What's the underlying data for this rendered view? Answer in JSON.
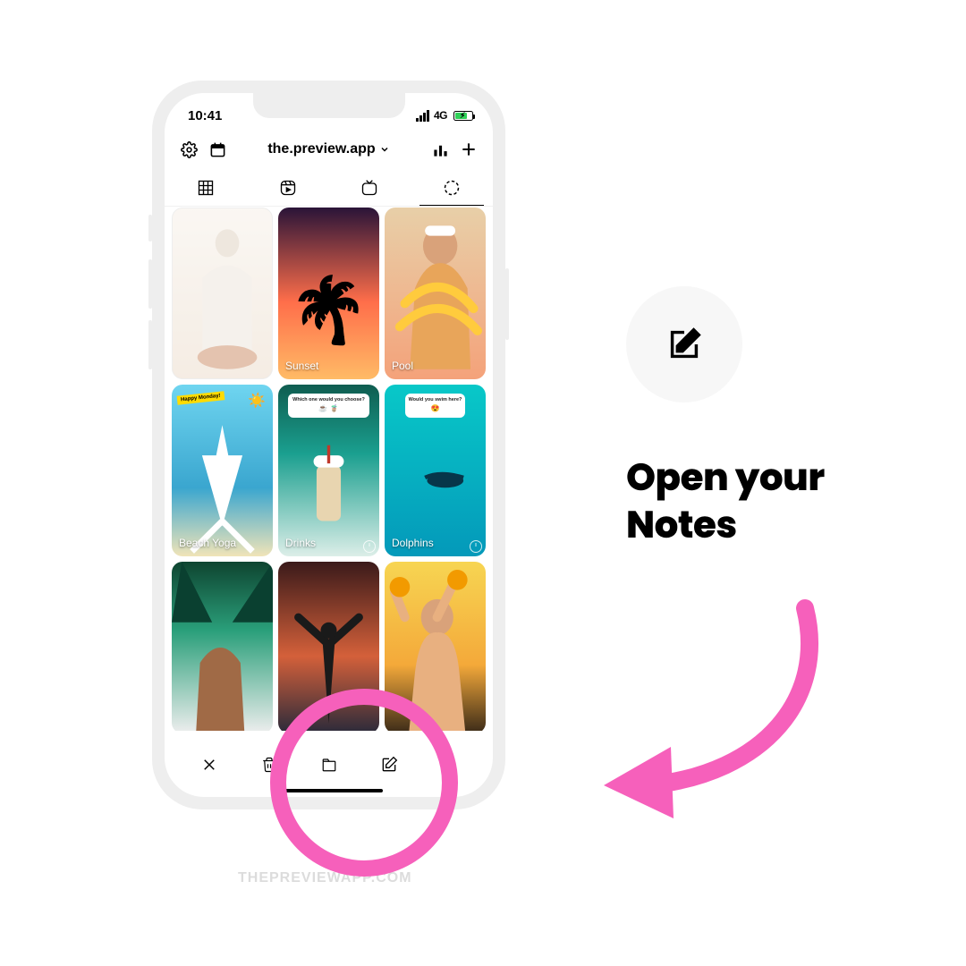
{
  "status": {
    "time": "10:41",
    "net": "4G"
  },
  "header": {
    "account": "the.preview.app"
  },
  "cards": [
    {
      "label": ""
    },
    {
      "label": "Sunset"
    },
    {
      "label": "Pool"
    },
    {
      "label": "Beach Yoga",
      "happy": "Happy\nMonday!"
    },
    {
      "label": "Drinks",
      "poll_q": "Which one would you choose?",
      "poll_e": "☕   🧋"
    },
    {
      "label": "Dolphins",
      "poll_q": "Would you swim here?",
      "poll_e": "😍"
    },
    {
      "label": ""
    },
    {
      "label": ""
    },
    {
      "label": ""
    }
  ],
  "callout": {
    "headline_l1": "Open your",
    "headline_l2": "Notes"
  },
  "watermark": "THEPREVIEWAPP.COM"
}
